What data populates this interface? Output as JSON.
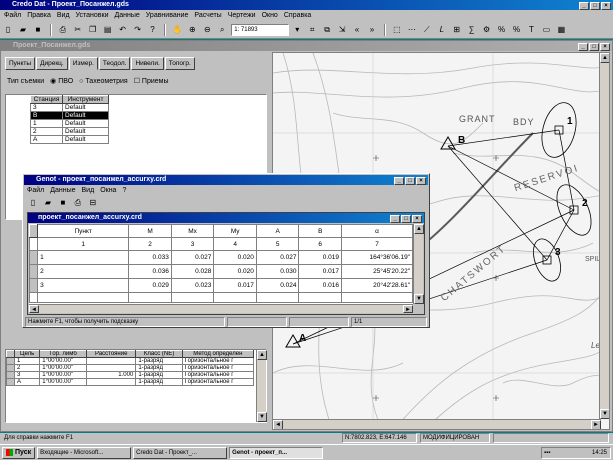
{
  "app": {
    "title": "Credo Dat - Проект_Посанжел.gds",
    "menu": [
      "Файл",
      "Правка",
      "Вид",
      "Установки",
      "Данные",
      "Уравнивание",
      "Расчеты",
      "Чертежи",
      "Окно",
      "Справка"
    ],
    "scale_value": "1: 71893"
  },
  "project_window": {
    "title": "Проект_Посанжел.gds",
    "tabs": [
      "Пункты",
      "Дирекц.",
      "Измер.",
      "Теодол.",
      "Нивели.",
      "Топогр."
    ],
    "survey_type_label": "Тип съемки",
    "radio_options": [
      "ПВО",
      "Тахеометрия",
      "Приемы"
    ],
    "station_table": {
      "headers": [
        "Станция",
        "Инструмент"
      ],
      "rows": [
        [
          "3",
          "Default"
        ],
        [
          "B",
          "Default"
        ],
        [
          "1",
          "Default"
        ],
        [
          "2",
          "Default"
        ],
        [
          "A",
          "Default"
        ]
      ]
    },
    "goal_table": {
      "headers": [
        "Цель",
        "Гор. лимб",
        "Расстояние",
        "Класс (NE)",
        "Метод определен"
      ],
      "rows": [
        [
          "1",
          "1°00'00.00\"",
          "",
          "1-разряд",
          "Горизонтальное г"
        ],
        [
          "2",
          "1°00'00.00\"",
          "",
          "1-разряд",
          "Горизонтальное г"
        ],
        [
          "3",
          "1°00'00.00\"",
          "1.000",
          "1-разряд",
          "Горизонтальное г"
        ],
        [
          "A",
          "1°00'00.00\"",
          "",
          "1-разряд",
          "Горизонтальное г"
        ]
      ]
    }
  },
  "genot_window": {
    "title": "Genot - проект_посанжел_accurxy.crd",
    "menu": [
      "Файл",
      "Данные",
      "Вид",
      "Окна",
      "?"
    ],
    "inner_title": "проект_посанжел_accurxy.crd",
    "headers": [
      "Пункт",
      "M",
      "Mx",
      "My",
      "A",
      "B",
      "α"
    ],
    "col_numbers": [
      "1",
      "2",
      "3",
      "4",
      "5",
      "6",
      "7"
    ],
    "rows": [
      [
        "1",
        "0.033",
        "0.027",
        "0.020",
        "0.027",
        "0.019",
        "164°36'06.19\""
      ],
      [
        "2",
        "0.036",
        "0.028",
        "0.020",
        "0.030",
        "0.017",
        "25°45'20.22\""
      ],
      [
        "3",
        "0.029",
        "0.023",
        "0.017",
        "0.024",
        "0.016",
        "20°42'28.61\""
      ]
    ],
    "status_hint": "Нажмите F1, чтобы получить подсказку",
    "status_page": "1/1"
  },
  "map": {
    "labels": [
      "B",
      "A",
      "1",
      "2",
      "3",
      "GRANT",
      "BDY",
      "RESERVOI",
      "CHATSWORT",
      "SPILL",
      "Lee"
    ]
  },
  "status_bar": {
    "hint": "Для справки нажмите F1",
    "coords": "N:7802.823, E:647.146",
    "mode": "МОДИФИЦИРОВАН"
  },
  "taskbar": {
    "start": "Пуск",
    "items": [
      "Входящие - Microsoft...",
      "Credo Dat - Проект_...",
      "Genot - проект_п..."
    ],
    "clock": "14:25"
  }
}
